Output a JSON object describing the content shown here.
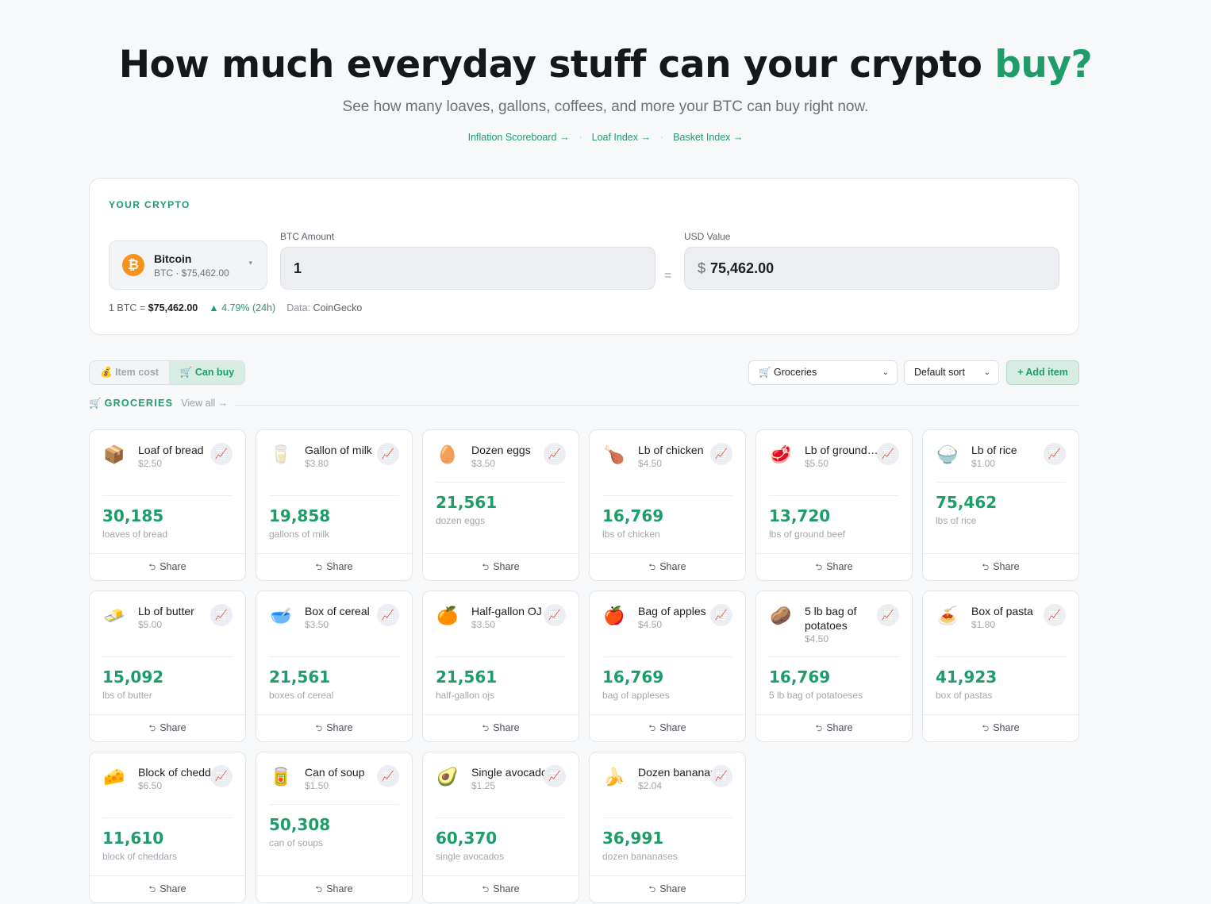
{
  "hero": {
    "title_main": "How much everyday stuff can your crypto ",
    "title_accent": "buy?",
    "subtitle": "See how many loaves, gallons, coffees, and more your BTC can buy right now.",
    "links": [
      "Inflation Scoreboard →",
      "Loaf Index →",
      "Basket Index →"
    ],
    "separator": "·"
  },
  "crypto": {
    "label": "YOUR CRYPTO",
    "coin_symbol_glyph": "₿",
    "coin_name": "Bitcoin",
    "coin_sub": "BTC · $75,462.00",
    "caret": "▾",
    "amount_label": "BTC Amount",
    "amount_value": "1",
    "equals": "=",
    "usd_label": "USD Value",
    "usd_symbol": "$",
    "usd_value": "75,462.00",
    "rate_prefix": "1 BTC = ",
    "rate_value": "$75,462.00",
    "change": "▲ 4.79% (24h)",
    "source_label": "Data: ",
    "source_value": "CoinGecko",
    "brand_color": "#1e9d6a",
    "coin_color": "#f7931a"
  },
  "controls": {
    "toggle_item_cost": "💰  Item cost",
    "toggle_can_buy": "🛒  Can buy",
    "category_select": "🛒  Groceries",
    "sort_select": "Default sort",
    "chevron": "⌄",
    "add_item": "+  Add item"
  },
  "section": {
    "icon": "🛒",
    "title": "GROCERIES",
    "view_all": "View all →"
  },
  "share_label": "Share",
  "share_icon": "⮌",
  "chart_icon": "📈",
  "items": [
    {
      "emoji": "📦",
      "name": "Loaf of bread",
      "price": "$2.50",
      "count": "30,185",
      "unit": "loaves of bread"
    },
    {
      "emoji": "🥛",
      "name": "Gallon of milk",
      "price": "$3.80",
      "count": "19,858",
      "unit": "gallons of milk"
    },
    {
      "emoji": "🥚",
      "name": "Dozen eggs",
      "price": "$3.50",
      "count": "21,561",
      "unit": "dozen eggs"
    },
    {
      "emoji": "🍗",
      "name": "Lb of chicken",
      "price": "$4.50",
      "count": "16,769",
      "unit": "lbs of chicken"
    },
    {
      "emoji": "🥩",
      "name": "Lb of ground…",
      "price": "$5.50",
      "count": "13,720",
      "unit": "lbs of ground beef"
    },
    {
      "emoji": "🍚",
      "name": "Lb of rice",
      "price": "$1.00",
      "count": "75,462",
      "unit": "lbs of rice"
    },
    {
      "emoji": "🧈",
      "name": "Lb of butter",
      "price": "$5.00",
      "count": "15,092",
      "unit": "lbs of butter"
    },
    {
      "emoji": "🥣",
      "name": "Box of cereal",
      "price": "$3.50",
      "count": "21,561",
      "unit": "boxes of cereal"
    },
    {
      "emoji": "🍊",
      "name": "Half-gallon OJ",
      "price": "$3.50",
      "count": "21,561",
      "unit": "half-gallon ojs"
    },
    {
      "emoji": "🍎",
      "name": "Bag of apples",
      "price": "$4.50",
      "count": "16,769",
      "unit": "bag of appleses"
    },
    {
      "emoji": "🥔",
      "name": "5 lb bag of potatoes",
      "price": "$4.50",
      "count": "16,769",
      "unit": "5 lb bag of potatoeses"
    },
    {
      "emoji": "🍝",
      "name": "Box of pasta",
      "price": "$1.80",
      "count": "41,923",
      "unit": "box of pastas"
    },
    {
      "emoji": "🧀",
      "name": "Block of cheddar",
      "price": "$6.50",
      "count": "11,610",
      "unit": "block of cheddars"
    },
    {
      "emoji": "🥫",
      "name": "Can of soup",
      "price": "$1.50",
      "count": "50,308",
      "unit": "can of soups"
    },
    {
      "emoji": "🥑",
      "name": "Single avocado",
      "price": "$1.25",
      "count": "60,370",
      "unit": "single avocados"
    },
    {
      "emoji": "🍌",
      "name": "Dozen bananas",
      "price": "$2.04",
      "count": "36,991",
      "unit": "dozen bananases"
    }
  ]
}
